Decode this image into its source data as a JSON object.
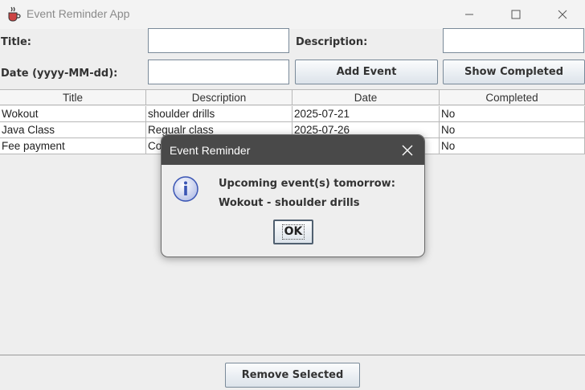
{
  "window": {
    "title": "Event Reminder App",
    "icon": "java-cup-icon"
  },
  "form": {
    "title_label": "Title:",
    "description_label": "Description:",
    "date_label": "Date (yyyy-MM-dd):",
    "title_value": "",
    "description_value": "",
    "date_value": "",
    "add_button": "Add Event",
    "show_completed_button": "Show Completed"
  },
  "table": {
    "columns": [
      "Title",
      "Description",
      "Date",
      "Completed"
    ],
    "rows": [
      [
        "Wokout",
        "shoulder drills",
        "2025-07-21",
        "No"
      ],
      [
        "Java Class",
        "Regualr class",
        "2025-07-26",
        "No"
      ],
      [
        "Fee payment",
        "Co",
        "",
        "No"
      ]
    ]
  },
  "remove_button": "Remove Selected",
  "dialog": {
    "title": "Event Reminder",
    "line1": "Upcoming event(s) tomorrow:",
    "line2": "Wokout - shoulder drills",
    "ok_button": "OK"
  },
  "colors": {
    "dialog_titlebar": "#494949",
    "info_icon": "#3a55b4"
  }
}
